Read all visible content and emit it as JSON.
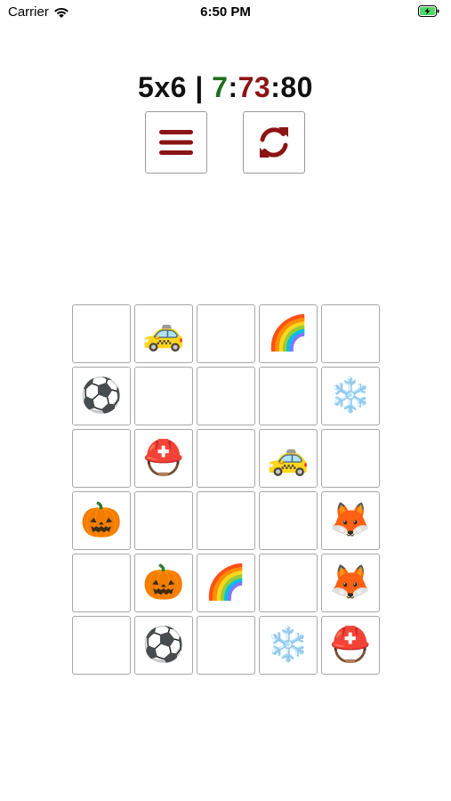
{
  "status_bar": {
    "carrier": "Carrier",
    "time": "6:50 PM"
  },
  "header": {
    "size": "5x6",
    "separator": " | ",
    "timer_part1": "7",
    "timer_sep1": ":",
    "timer_part2": "73",
    "timer_sep2": ":",
    "timer_part3": "80"
  },
  "controls": {
    "menu_icon": "menu-icon",
    "restart_icon": "refresh-icon",
    "accent_color": "#8b1414"
  },
  "board": {
    "columns": 5,
    "rows": 6,
    "cells": [
      "",
      "🚕",
      "",
      "🌈",
      "",
      "⚽",
      "",
      "",
      "",
      "❄️",
      "",
      "⛑️",
      "",
      "🚕",
      "",
      "🎃",
      "",
      "",
      "",
      "🦊",
      "",
      "🎃",
      "🌈",
      "",
      "🦊",
      "",
      "⚽",
      "",
      "❄️",
      "⛑️"
    ]
  }
}
